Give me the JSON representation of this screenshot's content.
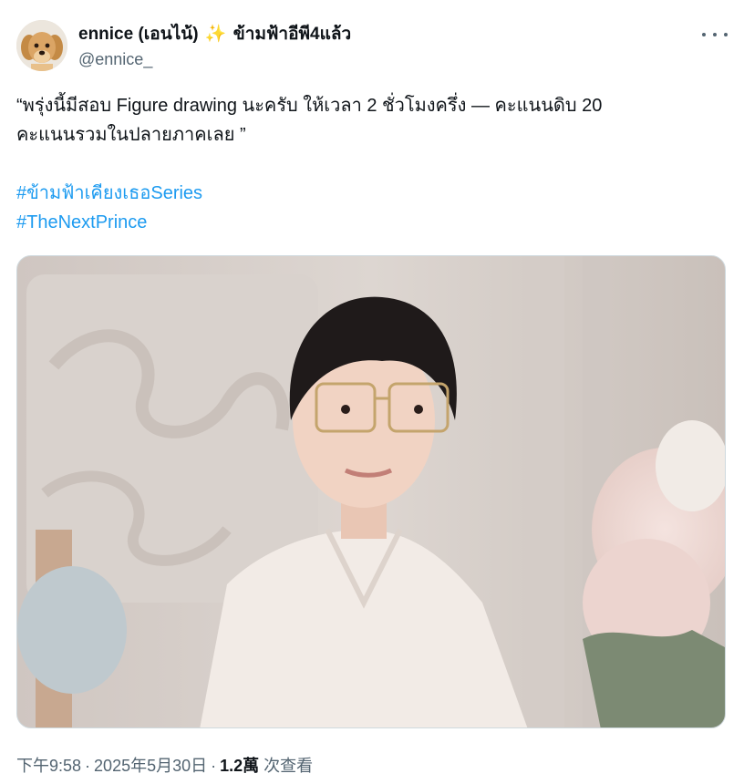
{
  "author": {
    "display_name": "ennice (เอนไน้)",
    "display_name_suffix": "ข้ามฟ้าอีพี4แล้ว",
    "sparkle_icon": "sparkles-icon",
    "handle": "@ennice_"
  },
  "tweet": {
    "text_line1": "“พรุ่งนี้มีสอบ Figure drawing  นะครับ ให้เวลา 2 ชั่วโมงครึ่ง — คะแนนดิบ 20",
    "text_line2": "คะแนนรวมในปลายภาคเลย ”",
    "hashtags": [
      "#ข้ามฟ้าเคียงเธอSeries",
      "#TheNextPrince"
    ]
  },
  "meta": {
    "time": "下午9:58",
    "separator": "·",
    "date": "2025年5月30日",
    "views_count": "1.2萬",
    "views_label": "次查看"
  },
  "colors": {
    "link": "#1d9bf0",
    "text": "#0f1419",
    "muted": "#536471"
  }
}
